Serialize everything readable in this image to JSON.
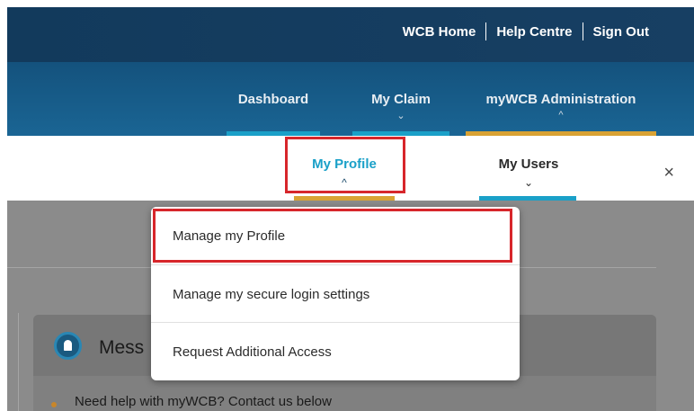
{
  "header": {
    "links": [
      "WCB Home",
      "Help Centre",
      "Sign Out"
    ]
  },
  "nav": {
    "items": [
      {
        "label": "Dashboard",
        "chevron": ""
      },
      {
        "label": "My Claim",
        "chevron": "⌄"
      },
      {
        "label": "myWCB Administration",
        "chevron": "^"
      }
    ]
  },
  "subnav": {
    "items": [
      {
        "label": "My Profile",
        "chevron": "^"
      },
      {
        "label": "My Users",
        "chevron": "⌄"
      }
    ],
    "close": "×"
  },
  "dropdown": {
    "items": [
      "Manage my Profile",
      "Manage my secure login settings",
      "Request Additional Access"
    ]
  },
  "messages": {
    "title": "Mess",
    "item": "Need help with myWCB? Contact us below"
  },
  "colors": {
    "highlight": "#d7262b",
    "active_sub": "#1aa0c8",
    "gold_underline": "#d9a233"
  }
}
